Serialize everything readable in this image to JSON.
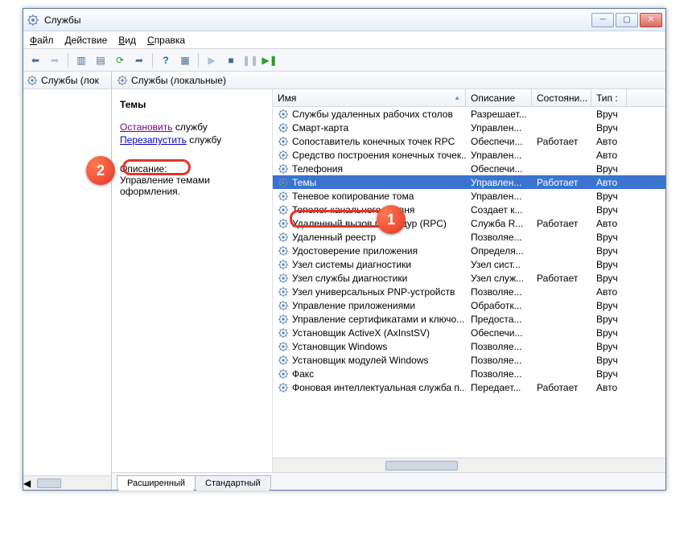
{
  "window": {
    "title": "Службы"
  },
  "menu": {
    "file": "Файл",
    "action": "Действие",
    "view": "Вид",
    "help": "Справка"
  },
  "tree": {
    "root": "Службы (лок"
  },
  "main": {
    "header": "Службы (локальные)",
    "desc": {
      "service_name": "Темы",
      "stop_link": "Остановить",
      "stop_suffix": " службу",
      "restart_link": "Перезапустить",
      "restart_suffix": " службу",
      "desc_label": "Описание:",
      "desc_text": "Управление темами оформления."
    },
    "columns": {
      "name": "Имя",
      "desc": "Описание",
      "state": "Состояни...",
      "type": "Тип :"
    },
    "col_widths": {
      "name": 240,
      "desc": 82,
      "state": 74,
      "type": 44
    },
    "rows": [
      {
        "name": "Службы удаленных рабочих столов",
        "desc": "Разрешает...",
        "state": "",
        "type": "Вруч"
      },
      {
        "name": "Смарт-карта",
        "desc": "Управлен...",
        "state": "",
        "type": "Вруч"
      },
      {
        "name": "Сопоставитель конечных точек RPC",
        "desc": "Обеспечи...",
        "state": "Работает",
        "type": "Авто"
      },
      {
        "name": "Средство построения конечных точек...",
        "desc": "Управлен...",
        "state": "",
        "type": "Авто"
      },
      {
        "name": "Телефония",
        "desc": "Обеспечи...",
        "state": "",
        "type": "Вруч"
      },
      {
        "name": "Темы",
        "desc": "Управлен...",
        "state": "Работает",
        "type": "Авто",
        "selected": true
      },
      {
        "name": "Теневое копирование тома",
        "desc": "Управлен...",
        "state": "",
        "type": "Вруч"
      },
      {
        "name": "Тополог канального уровня",
        "desc": "Создает к...",
        "state": "",
        "type": "Вруч"
      },
      {
        "name": "Удаленный вызов процедур (RPC)",
        "desc": "Служба R...",
        "state": "Работает",
        "type": "Авто"
      },
      {
        "name": "Удаленный реестр",
        "desc": "Позволяе...",
        "state": "",
        "type": "Вруч"
      },
      {
        "name": "Удостоверение приложения",
        "desc": "Определя...",
        "state": "",
        "type": "Вруч"
      },
      {
        "name": "Узел системы диагностики",
        "desc": "Узел сист...",
        "state": "",
        "type": "Вруч"
      },
      {
        "name": "Узел службы диагностики",
        "desc": "Узел служ...",
        "state": "Работает",
        "type": "Вруч"
      },
      {
        "name": "Узел универсальных PNP-устройств",
        "desc": "Позволяе...",
        "state": "",
        "type": "Авто"
      },
      {
        "name": "Управление приложениями",
        "desc": "Обработк...",
        "state": "",
        "type": "Вруч"
      },
      {
        "name": "Управление сертификатами и ключо...",
        "desc": "Предоста...",
        "state": "",
        "type": "Вруч"
      },
      {
        "name": "Установщик ActiveX (AxInstSV)",
        "desc": "Обеспечи...",
        "state": "",
        "type": "Вруч"
      },
      {
        "name": "Установщик Windows",
        "desc": "Позволяе...",
        "state": "",
        "type": "Вруч"
      },
      {
        "name": "Установщик модулей Windows",
        "desc": "Позволяе...",
        "state": "",
        "type": "Вруч"
      },
      {
        "name": "Факс",
        "desc": "Позволяе...",
        "state": "",
        "type": "Вруч"
      },
      {
        "name": "Фоновая интеллектуальная служба п...",
        "desc": "Передает...",
        "state": "Работает",
        "type": "Авто"
      }
    ],
    "tabs": {
      "extended": "Расширенный",
      "standard": "Стандартный"
    }
  },
  "annotations": {
    "badge1": "1",
    "badge2": "2"
  }
}
